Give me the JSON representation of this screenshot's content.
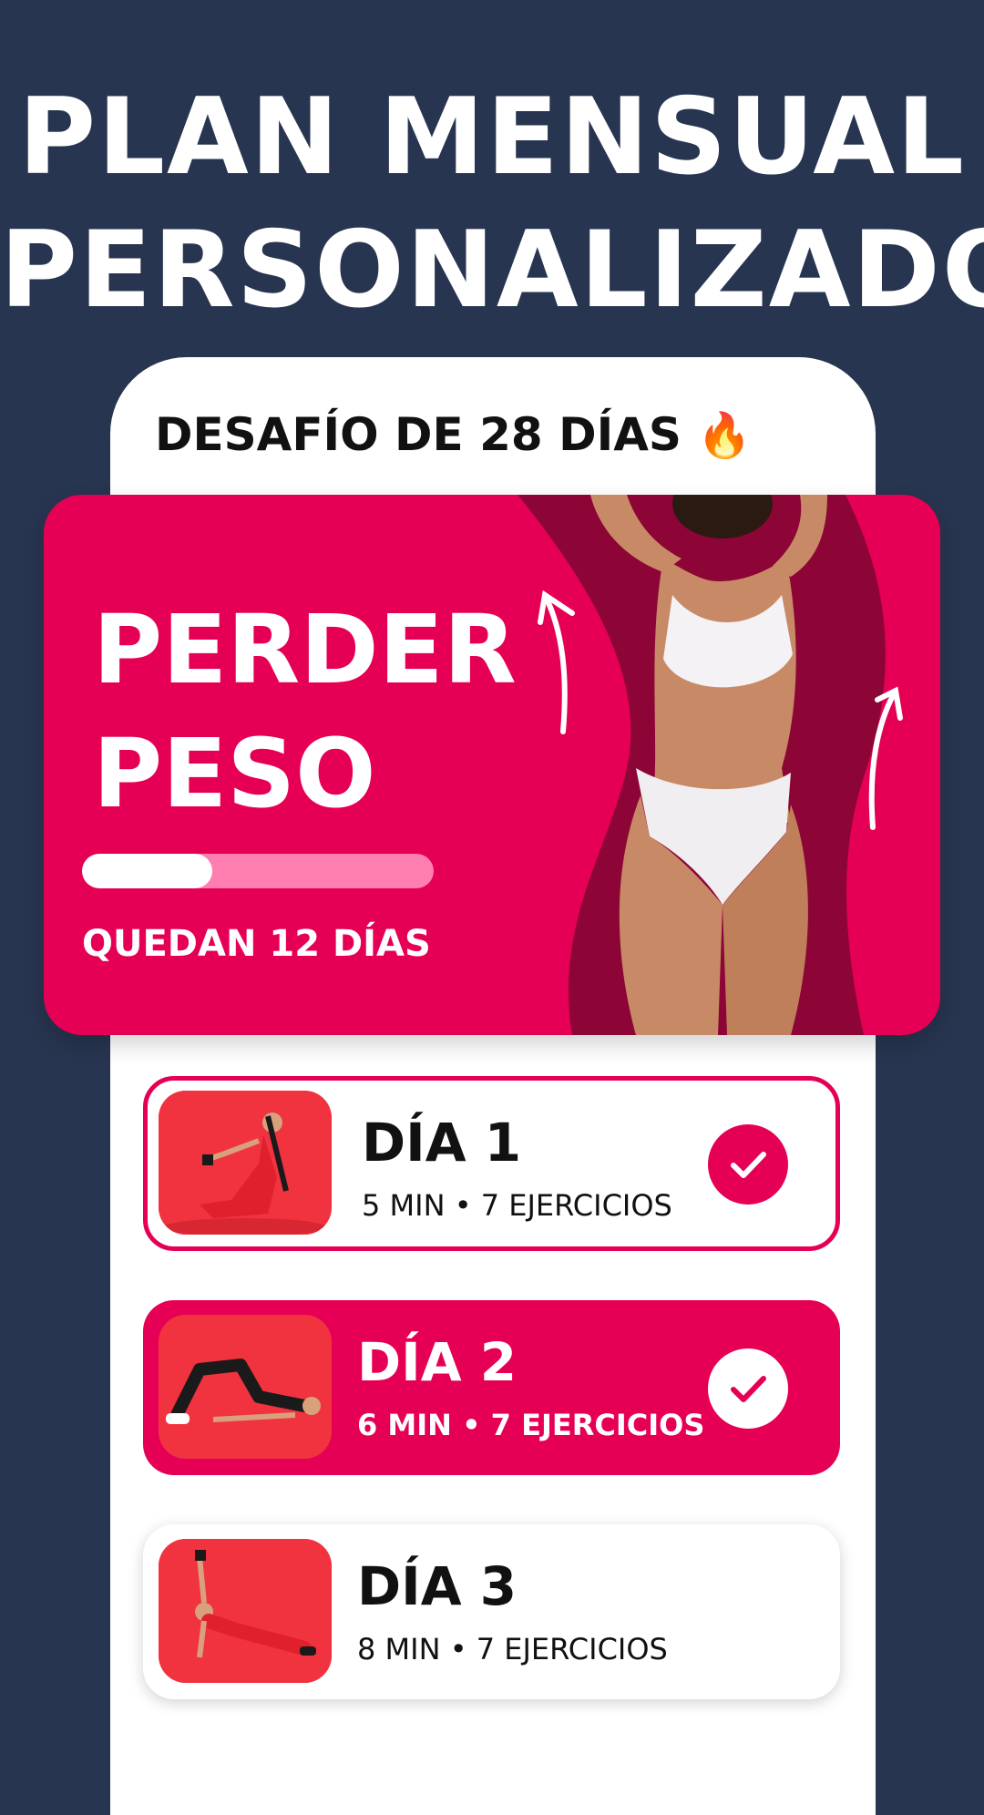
{
  "headline": {
    "line1": "PLAN MENSUAL",
    "line2": "PERSONALIZADO"
  },
  "challenge": {
    "title": "DESAFÍO DE 28 DÍAS",
    "flame": "🔥"
  },
  "plan": {
    "title_line1": "PERDER",
    "title_line2": "PESO",
    "progress_fraction": 0.37,
    "remaining_label": "QUEDAN 12 DÍAS"
  },
  "days": [
    {
      "title": "DÍA 1",
      "meta": "5 MIN • 7 EJERCICIOS",
      "status": "completed"
    },
    {
      "title": "DÍA 2",
      "meta": "6 MIN • 7 EJERCICIOS",
      "status": "completed"
    },
    {
      "title": "DÍA 3",
      "meta": "8 MIN • 7 EJERCICIOS",
      "status": "upcoming"
    }
  ],
  "colors": {
    "background": "#283550",
    "accent": "#e50055",
    "accent_dark": "#8c0536",
    "progress_track": "#ff7eb0"
  }
}
